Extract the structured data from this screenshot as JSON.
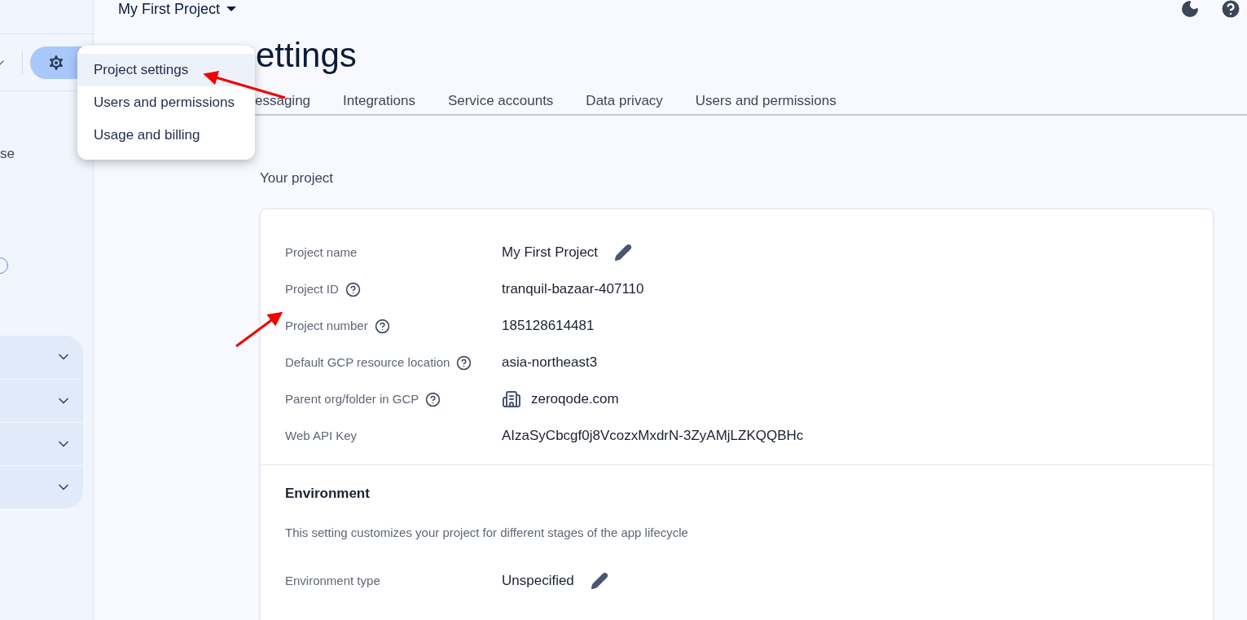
{
  "project_selector": {
    "label": "My First Project"
  },
  "sidebar": {
    "text_fragment": "se",
    "accordion_rows": [
      {
        "expanded": false
      },
      {
        "expanded": false
      },
      {
        "expanded": false
      },
      {
        "expanded": false
      }
    ]
  },
  "settings_menu": {
    "items": [
      {
        "label": "Project settings",
        "selected": true
      },
      {
        "label": "Users and permissions",
        "selected": false
      },
      {
        "label": "Usage and billing",
        "selected": false
      }
    ]
  },
  "heading": "ettings",
  "tabs": [
    {
      "label": "essaging",
      "selected": false
    },
    {
      "label": "Integrations",
      "selected": false
    },
    {
      "label": "Service accounts",
      "selected": false
    },
    {
      "label": "Data privacy",
      "selected": false
    },
    {
      "label": "Users and permissions",
      "selected": false
    }
  ],
  "section_title": "Your project",
  "fields": [
    {
      "label": "Project name",
      "help": false,
      "value": "My First Project",
      "kind": "editable"
    },
    {
      "label": "Project ID",
      "help": true,
      "value": "tranquil-bazaar-407110",
      "kind": "text"
    },
    {
      "label": "Project number",
      "help": true,
      "value": "185128614481",
      "kind": "text"
    },
    {
      "label": "Default GCP resource location",
      "help": true,
      "value": "asia-northeast3",
      "kind": "text"
    },
    {
      "label": "Parent org/folder in GCP",
      "help": true,
      "value": "zeroqode.com",
      "kind": "org"
    },
    {
      "label": "Web API Key",
      "help": false,
      "value": "AIzaSyCbcgf0j8VcozxMxdrN-3ZyAMjLZKQQBHc",
      "kind": "text"
    }
  ],
  "environment": {
    "title": "Environment",
    "description": "This setting customizes your project for different stages of the app lifecycle",
    "fields": [
      {
        "label": "Environment type",
        "help": false,
        "value": "Unspecified",
        "kind": "editable"
      }
    ]
  }
}
